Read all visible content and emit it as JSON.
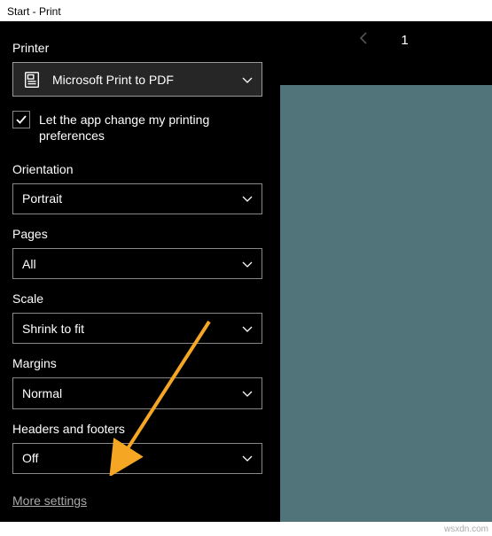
{
  "title_bar": "Start - Print",
  "labels": {
    "printer": "Printer",
    "orientation": "Orientation",
    "pages": "Pages",
    "scale": "Scale",
    "margins": "Margins",
    "headers_footers": "Headers and footers"
  },
  "printer": {
    "value": "Microsoft Print to PDF"
  },
  "checkbox": {
    "checked": true,
    "label": "Let the app change my printing preferences"
  },
  "orientation": {
    "value": "Portrait"
  },
  "pages": {
    "value": "All"
  },
  "scale": {
    "value": "Shrink to fit"
  },
  "margins": {
    "value": "Normal"
  },
  "headers_footers": {
    "value": "Off"
  },
  "more_settings": "More settings",
  "pager": {
    "current": "1"
  },
  "watermark": "wsxdn.com"
}
